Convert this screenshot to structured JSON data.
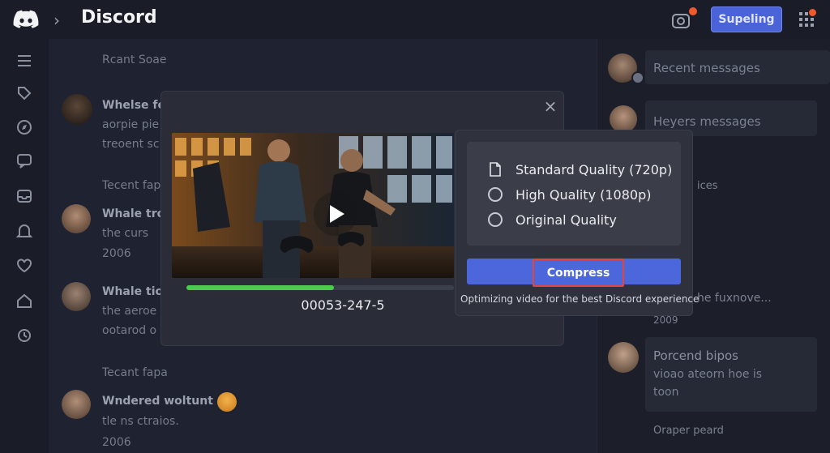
{
  "topbar": {
    "title": "Discord",
    "support_label": "Supeling"
  },
  "chat": {
    "section_1": "Rcant Soae",
    "message_1": {
      "name": "Whelse fe",
      "line_1": "aorpie pie",
      "line_2": "treoent sc"
    },
    "section_2": "Tecent fape",
    "message_2": {
      "name": "Whale tro",
      "line_1": "the curs",
      "line_2": "2006"
    },
    "message_3": {
      "name": "Whale tioe",
      "line_1": "the aeroe",
      "line_2": "ootarod o"
    },
    "section_3": "Tecant fapa",
    "message_4": {
      "name": "Wndered woltunt",
      "line_1": "tle ns ctraios.",
      "line_2": "2006"
    }
  },
  "right_panel": {
    "recent_messages": "Recent messages",
    "heyers_messages": "Heyers messages",
    "ices": "ices",
    "fragment": "he fuxnove...",
    "year": "2009",
    "card_title": "Porcend bipos",
    "card_line_1": "vioao ateorn hoe is",
    "card_line_2": "toon",
    "footer": "Oraper peard"
  },
  "modal": {
    "close": "×",
    "file_id": "00053-247-5",
    "progress": 0.55,
    "quality_options": [
      {
        "label": "Standard Quality (720p)",
        "icon": "file-icon"
      },
      {
        "label": "High Quality (1080p)",
        "icon": "radio-icon"
      },
      {
        "label": "Original Quality",
        "icon": "radio-icon"
      }
    ],
    "compress_label": "Compress",
    "hint": "Optimizing video for the best Discord experience"
  },
  "colors": {
    "accent": "#4c66dc",
    "progress": "#4ecb4e",
    "highlight": "#e0463c",
    "notification": "#f0592c"
  }
}
